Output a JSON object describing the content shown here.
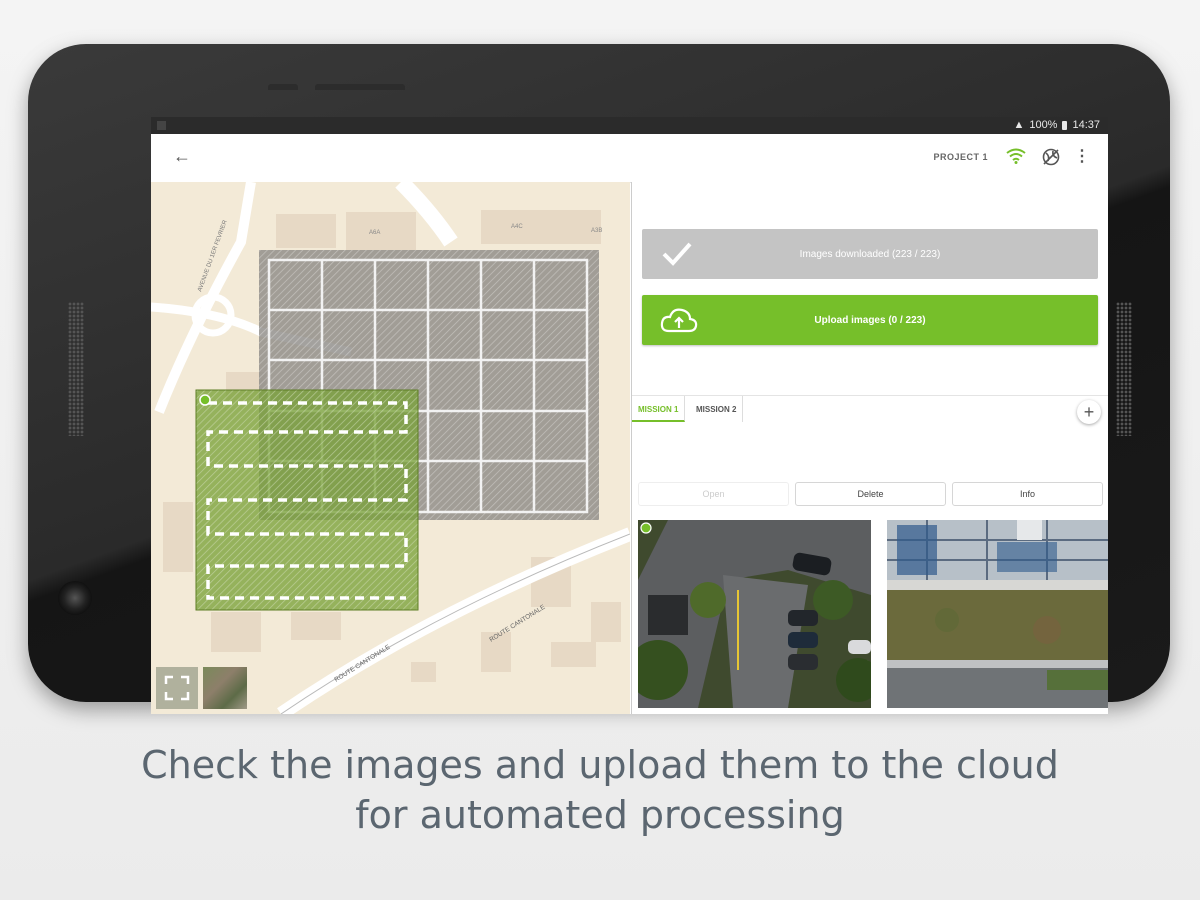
{
  "status_bar": {
    "battery": "100%",
    "time": "14:37"
  },
  "app_bar": {
    "project_label": "PROJECT 1"
  },
  "map": {
    "street_labels": [
      "AVENUE DU 1ER FEVRIER",
      "ROUTE CANTONALE",
      "ROUTE CANTONALE"
    ],
    "building_labels": [
      "A6A",
      "A4C",
      "A3B"
    ]
  },
  "images_card": {
    "downloaded_label": "Images downloaded (223 / 223)",
    "upload_label": "Upload images (0 / 223)"
  },
  "tabs": [
    {
      "label": "MISSION 1",
      "active": true
    },
    {
      "label": "MISSION 2",
      "active": false
    }
  ],
  "actions": {
    "open": "Open",
    "delete": "Delete",
    "info": "Info"
  },
  "colors": {
    "accent": "#76bf2a",
    "frame": "#2a2a2a",
    "caption": "#5b6670"
  },
  "caption": {
    "line1": "Check the images and upload them to the cloud",
    "line2": "for automated processing"
  }
}
